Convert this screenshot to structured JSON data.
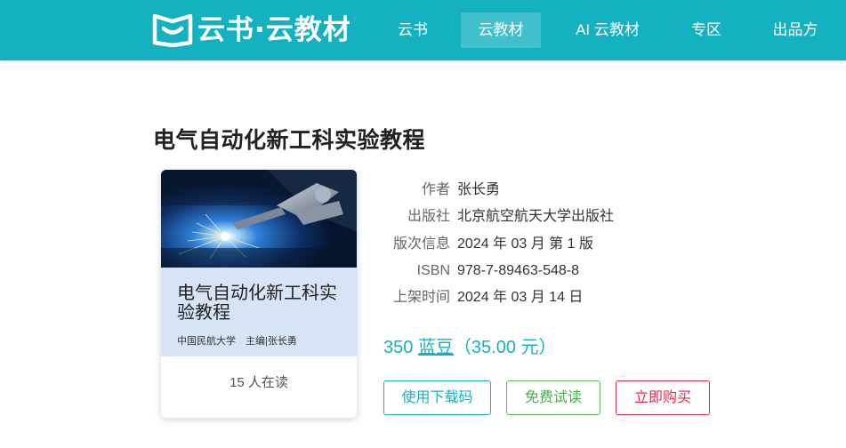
{
  "header": {
    "brand_text": "云书·云教材",
    "nav": [
      {
        "label": "云书",
        "active": false
      },
      {
        "label": "云教材",
        "active": true
      },
      {
        "label": "AI 云教材",
        "active": false
      },
      {
        "label": "专区",
        "active": false
      },
      {
        "label": "出品方",
        "active": false
      }
    ]
  },
  "book": {
    "title": "电气自动化新工科实验教程",
    "cover": {
      "title": "电气自动化新工科实验教程",
      "meta": "中国民航大学　主编|张长勇"
    },
    "readers": "15 人在读",
    "info": [
      {
        "label": "作者",
        "value": "张长勇"
      },
      {
        "label": "出版社",
        "value": "北京航空航天大学出版社"
      },
      {
        "label": "版次信息",
        "value": "2024 年 03 月 第 1 版"
      },
      {
        "label": "ISBN",
        "value": "978-7-89463-548-8"
      },
      {
        "label": "上架时间",
        "value": "2024 年 03 月 14 日"
      }
    ],
    "price": {
      "amount": "350",
      "unit": "蓝豆",
      "yuan": "（35.00 元）"
    }
  },
  "actions": {
    "download_code": "使用下载码",
    "free_trial": "免费试读",
    "buy_now": "立即购买"
  },
  "colors": {
    "brand": "#14b1c1",
    "trial": "#47b04b",
    "buy": "#e8294a",
    "cover_panel": "#d6e4f5"
  }
}
